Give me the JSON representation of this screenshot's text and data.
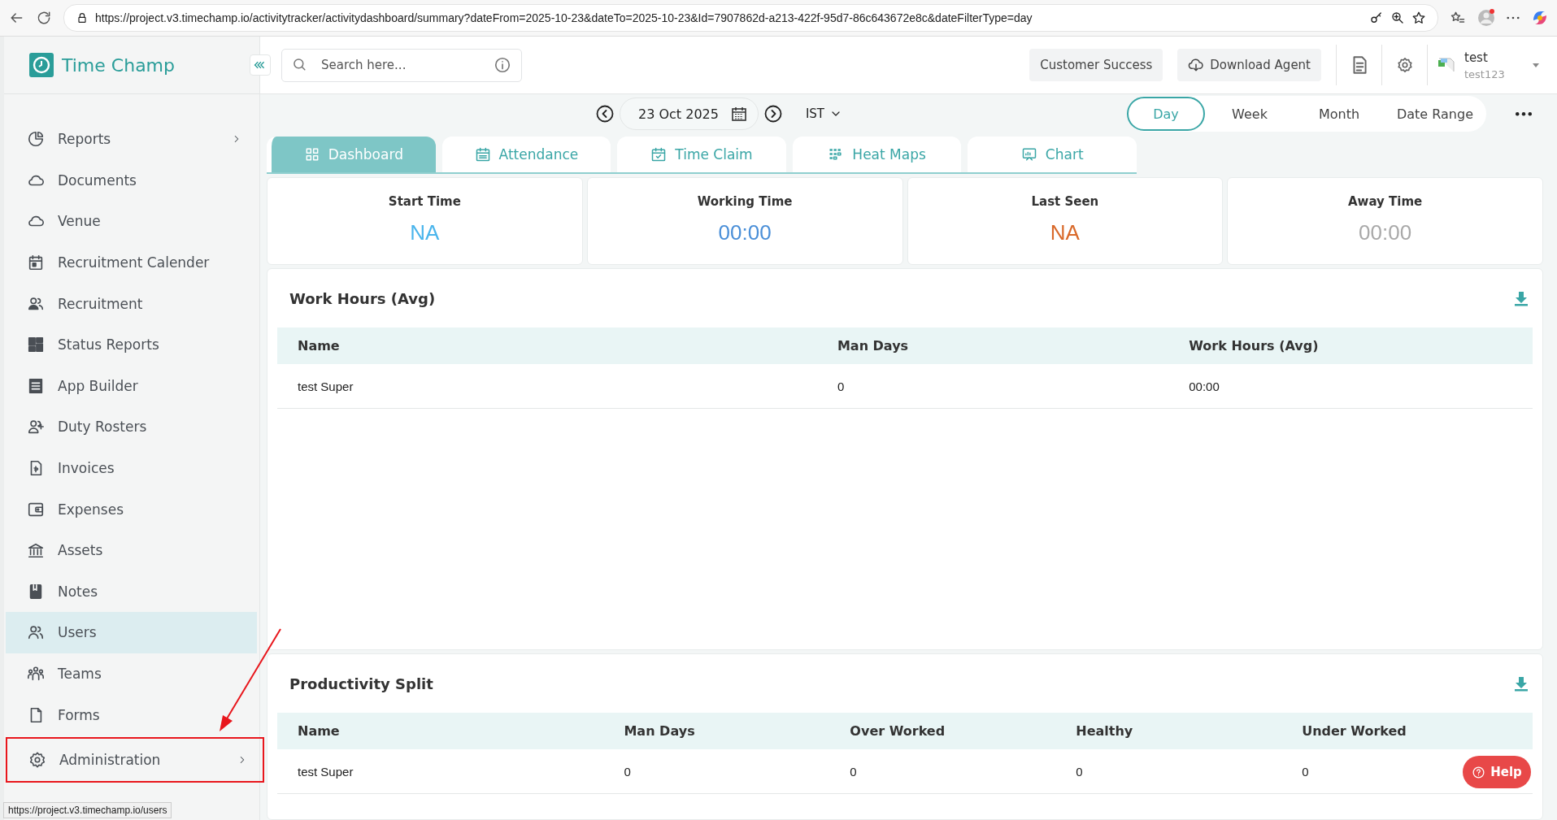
{
  "browser": {
    "url": "https://project.v3.timechamp.io/activitytracker/activitydashboard/summary?dateFrom=2025-10-23&dateTo=2025-10-23&Id=7907862d-a213-422f-95d7-86c643672e8c&dateFilterType=day",
    "status_url": "https://project.v3.timechamp.io/users"
  },
  "sidebar": {
    "logo": "Time Champ",
    "items": [
      {
        "label": "Reports",
        "selected": false,
        "expandable": true,
        "annotated": false
      },
      {
        "label": "Documents",
        "selected": false,
        "expandable": false,
        "annotated": false
      },
      {
        "label": "Venue",
        "selected": false,
        "expandable": false,
        "annotated": false
      },
      {
        "label": "Recruitment Calender",
        "selected": false,
        "expandable": false,
        "annotated": false
      },
      {
        "label": "Recruitment",
        "selected": false,
        "expandable": false,
        "annotated": false
      },
      {
        "label": "Status Reports",
        "selected": false,
        "expandable": false,
        "annotated": false
      },
      {
        "label": "App Builder",
        "selected": false,
        "expandable": false,
        "annotated": false
      },
      {
        "label": "Duty Rosters",
        "selected": false,
        "expandable": false,
        "annotated": false
      },
      {
        "label": "Invoices",
        "selected": false,
        "expandable": false,
        "annotated": false
      },
      {
        "label": "Expenses",
        "selected": false,
        "expandable": false,
        "annotated": false
      },
      {
        "label": "Assets",
        "selected": false,
        "expandable": false,
        "annotated": false
      },
      {
        "label": "Notes",
        "selected": false,
        "expandable": false,
        "annotated": false
      },
      {
        "label": "Users",
        "selected": true,
        "expandable": false,
        "annotated": false
      },
      {
        "label": "Teams",
        "selected": false,
        "expandable": false,
        "annotated": false
      },
      {
        "label": "Forms",
        "selected": false,
        "expandable": false,
        "annotated": false
      },
      {
        "label": "Administration",
        "selected": false,
        "expandable": true,
        "annotated": true
      }
    ]
  },
  "header": {
    "search": {
      "placeholder": "Search here..."
    },
    "buttons": [
      "Customer Success",
      "Download Agent"
    ],
    "user": {
      "name": "test",
      "id": "test123"
    }
  },
  "date_bar": {
    "date": "23 Oct 2025",
    "timezone": "IST",
    "ranges": [
      {
        "label": "Day",
        "selected": true
      },
      {
        "label": "Week",
        "selected": false
      },
      {
        "label": "Month",
        "selected": false
      },
      {
        "label": "Date Range",
        "selected": false
      }
    ]
  },
  "tabs": [
    {
      "label": "Dashboard",
      "selected": true
    },
    {
      "label": "Attendance",
      "selected": false
    },
    {
      "label": "Time Claim",
      "selected": false
    },
    {
      "label": "Heat Maps",
      "selected": false
    },
    {
      "label": "Chart",
      "selected": false
    }
  ],
  "stats": [
    {
      "label": "Start Time",
      "value": "NA",
      "color": "#4ab5ec"
    },
    {
      "label": "Working Time",
      "value": "00:00",
      "color": "#4a8fd8"
    },
    {
      "label": "Last Seen",
      "value": "NA",
      "color": "#d9692a"
    },
    {
      "label": "Away Time",
      "value": "00:00",
      "color": "#a9a9a9"
    }
  ],
  "work_hours": {
    "title": "Work Hours (Avg)",
    "columns": [
      "Name",
      "Man Days",
      "Work Hours (Avg)"
    ],
    "rows": [
      [
        "test Super",
        "0",
        "00:00"
      ]
    ]
  },
  "productivity": {
    "title": "Productivity Split",
    "columns": [
      "Name",
      "Man Days",
      "Over Worked",
      "Healthy",
      "Under Worked"
    ],
    "rows": [
      [
        "test Super",
        "0",
        "0",
        "0",
        "0"
      ]
    ]
  },
  "help": {
    "label": "Help"
  }
}
